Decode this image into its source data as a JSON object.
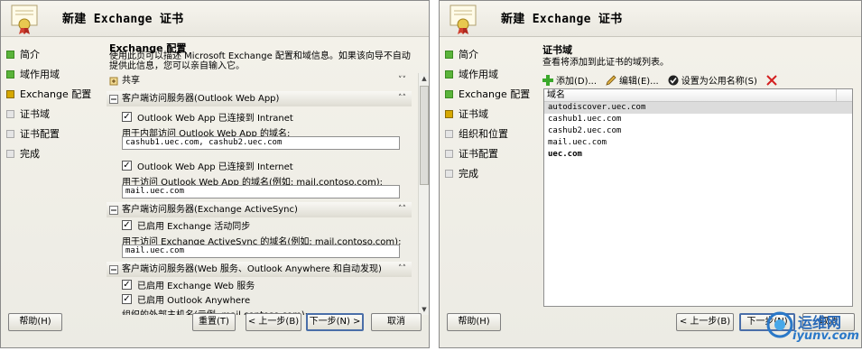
{
  "left": {
    "title": "新建 Exchange 证书",
    "nav": [
      {
        "label": "简介",
        "state": "done"
      },
      {
        "label": "域作用域",
        "state": "done"
      },
      {
        "label": "Exchange 配置",
        "state": "current"
      },
      {
        "label": "证书域",
        "state": "todo"
      },
      {
        "label": "证书配置",
        "state": "todo"
      },
      {
        "label": "完成",
        "state": "todo"
      }
    ],
    "content_title": "Exchange 配置",
    "content_desc": "使用此页可以描述 Microsoft Exchange 配置和域信息。如果该向导不自动提供此信息，您可以亲自输入它。",
    "shared_label": "共享",
    "owa": {
      "header": "客户端访问服务器(Outlook Web App)",
      "intranet_check": "Outlook Web App 已连接到 Intranet",
      "intranet_label": "用于内部访问 Outlook Web App 的域名:",
      "intranet_value": "cashub1.uec.com, cashub2.uec.com",
      "internet_check": "Outlook Web App 已连接到 Internet",
      "internet_label": "用于访问 Outlook Web App 的域名(例如: mail.contoso.com):",
      "internet_value": "mail.uec.com"
    },
    "eas": {
      "header": "客户端访问服务器(Exchange ActiveSync)",
      "enabled_check": "已启用 Exchange 活动同步",
      "domain_label": "用于访问 Exchange ActiveSync 的域名(例如: mail.contoso.com):",
      "domain_value": "mail.uec.com"
    },
    "ews": {
      "header": "客户端访问服务器(Web 服务、Outlook Anywhere 和自动发现)",
      "ews_check": "已启用 Exchange Web 服务",
      "oa_check": "已启用 Outlook Anywhere",
      "external_label": "组织的外部主机名(示例: mail.contoso.com):"
    },
    "buttons": {
      "help": "帮助(H)",
      "reset": "重置(T)",
      "back": "< 上一步(B)",
      "next": "下一步(N) >",
      "cancel": "取消"
    }
  },
  "right": {
    "title": "新建 Exchange 证书",
    "nav": [
      {
        "label": "简介",
        "state": "done"
      },
      {
        "label": "域作用域",
        "state": "done"
      },
      {
        "label": "Exchange 配置",
        "state": "done"
      },
      {
        "label": "证书域",
        "state": "current"
      },
      {
        "label": "组织和位置",
        "state": "todo"
      },
      {
        "label": "证书配置",
        "state": "todo"
      },
      {
        "label": "完成",
        "state": "todo"
      }
    ],
    "content_title": "证书域",
    "content_desc": "查看将添加到此证书的域列表。",
    "toolbar": {
      "add": "添加(D)...",
      "edit": "编辑(E)...",
      "set_common": "设置为公用名称(S)"
    },
    "list_header": "域名",
    "domains": [
      {
        "name": "autodiscover.uec.com",
        "selected": true,
        "bold": false
      },
      {
        "name": "cashub1.uec.com",
        "selected": false,
        "bold": false
      },
      {
        "name": "cashub2.uec.com",
        "selected": false,
        "bold": false
      },
      {
        "name": "mail.uec.com",
        "selected": false,
        "bold": false
      },
      {
        "name": "uec.com",
        "selected": false,
        "bold": true
      }
    ],
    "buttons": {
      "help": "帮助(H)",
      "back": "< 上一步(B)",
      "next": "下一步(N)",
      "cancel": "取消"
    }
  },
  "watermark": {
    "text": "运维网",
    "url": "iyunv.com"
  },
  "colors": {
    "done": "#5ab43a",
    "current": "#d6a800",
    "todo": "#e5e5e5"
  }
}
